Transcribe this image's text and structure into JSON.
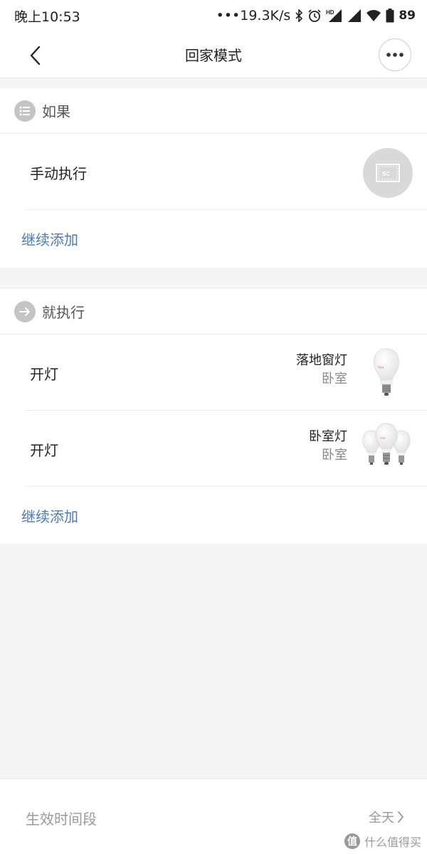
{
  "status_bar": {
    "time": "晚上10:53",
    "network_speed": "19.3K/s",
    "battery": "89"
  },
  "header": {
    "title": "回家模式",
    "back_icon": "chevron-left-icon",
    "more_icon": "more-horizontal-icon"
  },
  "if_section": {
    "title": "如果",
    "rows": [
      {
        "label": "手动执行"
      }
    ],
    "add_label": "继续添加"
  },
  "then_section": {
    "title": "就执行",
    "rows": [
      {
        "label": "开灯",
        "device_name": "落地窗灯",
        "room": "卧室"
      },
      {
        "label": "开灯",
        "device_name": "卧室灯",
        "room": "卧室"
      }
    ],
    "add_label": "继续添加"
  },
  "bottom_bar": {
    "label": "生效时间段",
    "value": "全天"
  },
  "watermark": {
    "logo": "值",
    "text": "什么值得买"
  },
  "colors": {
    "link": "#4a7ab4",
    "background": "#f5f5f5",
    "section_icon": "#c4c4c4"
  }
}
